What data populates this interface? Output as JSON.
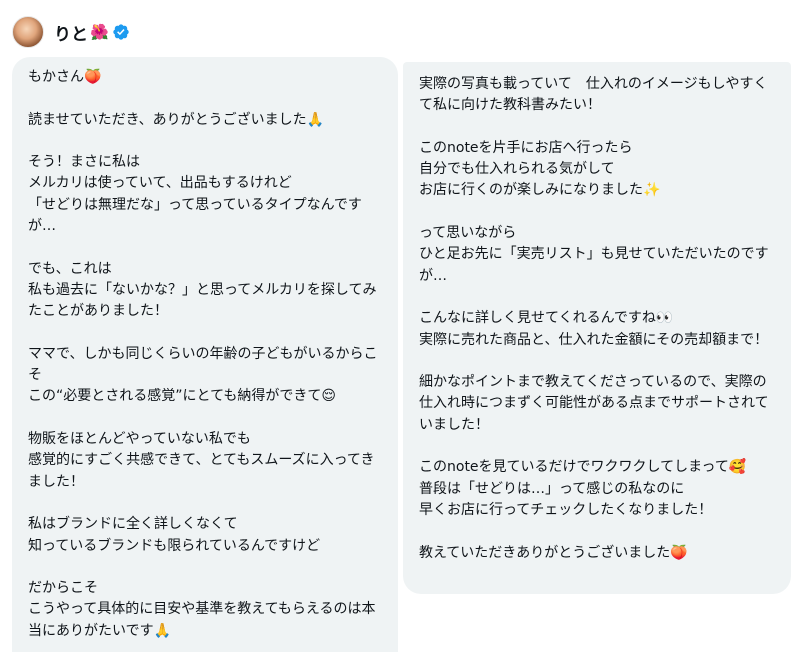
{
  "header": {
    "display_name": "りと",
    "name_emoji": "🌺",
    "verified_icon": "verified-badge-icon",
    "avatar_icon": "avatar"
  },
  "colors": {
    "bubble_bg": "#eff3f4",
    "verified_blue": "#1d9bf0",
    "text": "#0f1419"
  },
  "messages": {
    "left": [
      "もかさん🍑",
      "読ませていただき、ありがとうございました🙏",
      "そう！まさに私は\nメルカリは使っていて、出品もするけれど\n「せどりは無理だな」って思っているタイプなんですが…",
      "でも、これは\n私も過去に「ないかな？」と思ってメルカリを探してみたことがありました！",
      "ママで、しかも同じくらいの年齢の子どもがいるからこそ\nこの“必要とされる感覚”にとても納得ができて😌",
      "物販をほとんどやっていない私でも\n感覚的にすごく共感できて、とてもスムーズに入ってきました！",
      "私はブランドに全く詳しくなくて\n知っているブランドも限られているんですけど",
      "だからこそ\nこうやって具体的に目安や基準を教えてもらえるのは本当にありがたいです🙏"
    ],
    "right": [
      "実際の写真も載っていて　仕入れのイメージもしやすくて私に向けた教科書みたい！",
      "このnoteを片手にお店へ行ったら\n自分でも仕入れられる気がして\nお店に行くのが楽しみになりました✨",
      "って思いながら\nひと足お先に「実売リスト」も見せていただいたのですが…",
      "こんなに詳しく見せてくれるんですね👀\n実際に売れた商品と、仕入れた金額にその売却額まで！",
      "細かなポイントまで教えてくださっているので、実際の仕入れ時につまずく可能性がある点までサポートされていました！",
      "このnoteを見ているだけでワクワクしてしまって🥰\n普段は「せどりは…」って感じの私なのに\n早くお店に行ってチェックしたくなりました！",
      "教えていただきありがとうございました🍑"
    ]
  }
}
